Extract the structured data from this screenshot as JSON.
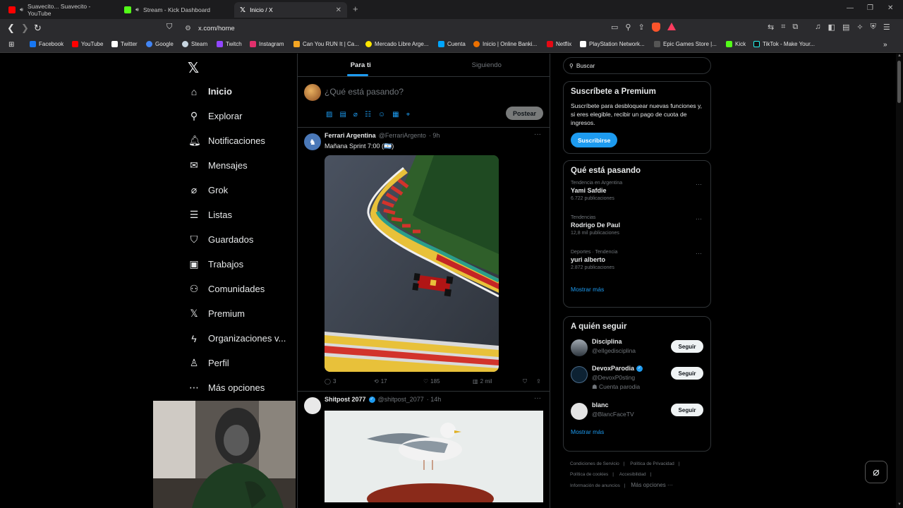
{
  "browser": {
    "tabs": [
      {
        "title": "Suavecito... Suavecito - YouTube",
        "color": "#ff0000",
        "audio": true,
        "active": false
      },
      {
        "title": "Stream - Kick Dashboard",
        "color": "#53fc18",
        "audio": true,
        "active": false
      },
      {
        "title": "Inicio / X",
        "color": "#ffffff",
        "audio": false,
        "active": true
      }
    ],
    "new_tab": "+",
    "url": "x.com/home",
    "shields_badge": "1",
    "bookmarks": [
      {
        "label": "Facebook",
        "color": "#1877f2"
      },
      {
        "label": "YouTube",
        "color": "#ff0000"
      },
      {
        "label": "Twitter",
        "color": "#ffffff"
      },
      {
        "label": "Google",
        "color": "#4285f4"
      },
      {
        "label": "Steam",
        "color": "#1b2838"
      },
      {
        "label": "Twitch",
        "color": "#9146ff"
      },
      {
        "label": "Instagram",
        "color": "#e1306c"
      },
      {
        "label": "Can You RUN It | Ca...",
        "color": "#f5a623"
      },
      {
        "label": "Mercado Libre Arge...",
        "color": "#ffe600"
      },
      {
        "label": "Cuenta",
        "color": "#00a6ff"
      },
      {
        "label": "Inicio | Online Banki...",
        "color": "#ec7000"
      },
      {
        "label": "Netflix",
        "color": "#e50914"
      },
      {
        "label": "PlayStation Network...",
        "color": "#ffffff"
      },
      {
        "label": "Epic Games Store |...",
        "color": "#2a2a2a"
      },
      {
        "label": "Kick",
        "color": "#53fc18"
      },
      {
        "label": "TikTok - Make Your...",
        "color": "#111111"
      }
    ]
  },
  "nav": {
    "items": [
      {
        "label": "Inicio",
        "icon": "home-icon",
        "glyph": "⌂",
        "active": true
      },
      {
        "label": "Explorar",
        "icon": "search-icon",
        "glyph": "⚲",
        "active": false
      },
      {
        "label": "Notificaciones",
        "icon": "bell-icon",
        "glyph": "🔔︎",
        "active": false
      },
      {
        "label": "Mensajes",
        "icon": "envelope-icon",
        "glyph": "✉",
        "active": false
      },
      {
        "label": "Grok",
        "icon": "grok-icon",
        "glyph": "⌀",
        "active": false
      },
      {
        "label": "Listas",
        "icon": "list-icon",
        "glyph": "☰",
        "active": false
      },
      {
        "label": "Guardados",
        "icon": "bookmark-icon",
        "glyph": "⛉",
        "active": false
      },
      {
        "label": "Trabajos",
        "icon": "briefcase-icon",
        "glyph": "▣",
        "active": false
      },
      {
        "label": "Comunidades",
        "icon": "people-icon",
        "glyph": "⚇",
        "active": false
      },
      {
        "label": "Premium",
        "icon": "x-icon",
        "glyph": "𝕏",
        "active": false
      },
      {
        "label": "Organizaciones v...",
        "icon": "lightning-icon",
        "glyph": "ϟ",
        "active": false
      },
      {
        "label": "Perfil",
        "icon": "person-icon",
        "glyph": "♙",
        "active": false
      },
      {
        "label": "Más opciones",
        "icon": "more-icon",
        "glyph": "⋯",
        "active": false
      }
    ]
  },
  "timeline": {
    "tabs": [
      "Para ti",
      "Siguiendo"
    ],
    "compose_placeholder": "¿Qué está pasando?",
    "post_button": "Postear",
    "tweets": [
      {
        "name": "Ferrari Argentina",
        "handle": "@FerrariArgento",
        "time": "· 9h",
        "text": "Mañana Sprint 7:00 (🇦🇷)",
        "replies": "3",
        "reposts": "17",
        "likes": "185",
        "views": "2 mil"
      },
      {
        "name": "Shitpost 2077",
        "handle": "@shitpost_2077",
        "time": "· 14h",
        "verified": true
      }
    ]
  },
  "sidebar": {
    "search_placeholder": "Buscar",
    "premium": {
      "title": "Suscríbete a Premium",
      "text": "Suscríbete para desbloquear nuevas funciones y, si eres elegible, recibir un pago de cuota de ingresos.",
      "button": "Suscribirse"
    },
    "trends": {
      "title": "Qué está pasando",
      "items": [
        {
          "context": "Tendencia en Argentina",
          "topic": "Yami Safdie",
          "count": "6.722 publicaciones"
        },
        {
          "context": "Tendencias",
          "topic": "Rodrigo De Paul",
          "count": "12,8 mil publicaciones"
        },
        {
          "context": "Deportes · Tendencia",
          "topic": "yuri alberto",
          "count": "2.872 publicaciones"
        }
      ],
      "more": "Mostrar más"
    },
    "who_to_follow": {
      "title": "A quién seguir",
      "items": [
        {
          "name": "Disciplina",
          "handle": "@elIgedisciplina",
          "note": "",
          "verified": false,
          "button": "Seguir"
        },
        {
          "name": "DevoxParodia",
          "handle": "@DevoxP0sting",
          "note": "Cuenta parodia",
          "verified": true,
          "button": "Seguir"
        },
        {
          "name": "blanc",
          "handle": "@BlancFaceTV",
          "note": "",
          "verified": false,
          "button": "Seguir"
        }
      ],
      "more": "Mostrar más"
    },
    "footer": [
      "Condiciones de Servicio",
      "Política de Privacidad",
      "Política de cookies",
      "Accesibilidad",
      "Información de anuncios",
      "Más opciones ···"
    ]
  },
  "colors": {
    "accent": "#1d9bf0",
    "background": "#000000",
    "border": "#2f3336",
    "muted": "#71767b"
  }
}
